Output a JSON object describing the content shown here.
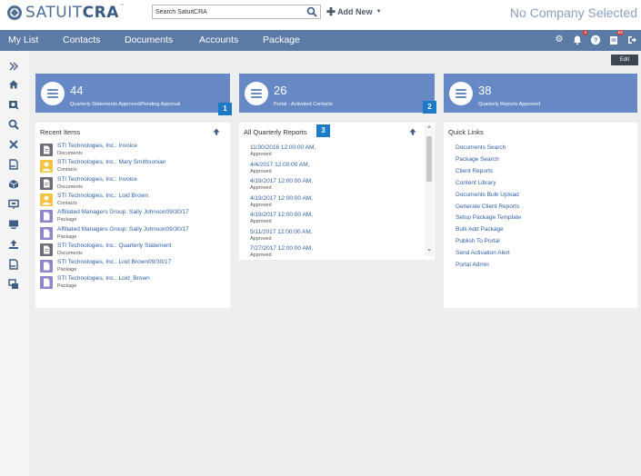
{
  "header": {
    "brand_light": "SATUIT",
    "brand_bold": "CRA",
    "brand_tm": "™",
    "search_placeholder": "Search SatuitCRA",
    "add_new_label": "Add New",
    "company": "No Company Selected"
  },
  "nav": {
    "items": [
      "My List",
      "Contacts",
      "Documents",
      "Accounts",
      "Package"
    ],
    "notification_count": "4",
    "tasks_count": "62"
  },
  "toolbar": {
    "edit_label": "Edit"
  },
  "tiles": [
    {
      "number": "44",
      "label": "Quarterly Statements Approved/Pending Approval",
      "badge": "1"
    },
    {
      "number": "26",
      "label": "Portal - Activated Contacts",
      "badge": "2"
    },
    {
      "number": "38",
      "label": "Quarterly Reports Approved"
    }
  ],
  "recent": {
    "title": "Recent Items",
    "items": [
      {
        "name": "STI Technologies, Inc.: Invoice",
        "type": "Documents",
        "icon": "document-icon"
      },
      {
        "name": "STI Technologies, Inc.: Mary Smithsonian",
        "type": "Contacts",
        "icon": "contact-icon"
      },
      {
        "name": "STI Technologies, Inc.: Invoice",
        "type": "Documents",
        "icon": "document-icon"
      },
      {
        "name": "STI Technologies, Inc.: Loid Brown",
        "type": "Contacts",
        "icon": "contact-icon"
      },
      {
        "name": "Affiliated Managers Group: Sally Johnson09/30/17",
        "type": "Package",
        "icon": "package-icon"
      },
      {
        "name": "Affiliated Managers Group: Sally Johnson09/30/17",
        "type": "Package",
        "icon": "package-icon"
      },
      {
        "name": "STI Technologies, Inc.: Quarterly Statement",
        "type": "Documents",
        "icon": "document-icon"
      },
      {
        "name": "STI Technologies, Inc.: Loid Brown09/30/17",
        "type": "Package",
        "icon": "package-icon"
      },
      {
        "name": "STI Technologies, Inc.: Loid_Brown",
        "type": "Package",
        "icon": "package-icon"
      }
    ]
  },
  "reports": {
    "title": "All Quarterly Reports",
    "badge": "3",
    "items": [
      {
        "date": "11/30/2016 12:00:00 AM,",
        "status": "Approved"
      },
      {
        "date": "4/4/2017 12:00:00 AM,",
        "status": "Approved"
      },
      {
        "date": "4/19/2017 12:00:00 AM,",
        "status": "Approved"
      },
      {
        "date": "4/19/2017 12:00:00 AM,",
        "status": "Approved"
      },
      {
        "date": "4/19/2017 12:00:00 AM,",
        "status": "Approved"
      },
      {
        "date": "5/11/2017 12:00:00 AM,",
        "status": "Approved"
      },
      {
        "date": "7/27/2017 12:00:00 AM,",
        "status": "Approved"
      }
    ]
  },
  "quick_links": {
    "title": "Quick Links",
    "items": [
      "Documents Search",
      "Package Search",
      "Client Reports",
      "Content Library",
      "Documents Bulk Upload",
      "Generate Client Reports",
      "Setup Package Template",
      "Bulk Add Package",
      "Publish To Portal",
      "Send Activation Alert",
      "Portal Admin"
    ]
  },
  "colors": {
    "nav_bg": "#5b7aa6",
    "tile_bg": "#6688c4",
    "badge_bg": "#1d7ac9",
    "link": "#2f5fa8",
    "document_icon": "#6b6f7a",
    "contact_icon": "#f2c443",
    "package_icon": "#8f86c9"
  }
}
